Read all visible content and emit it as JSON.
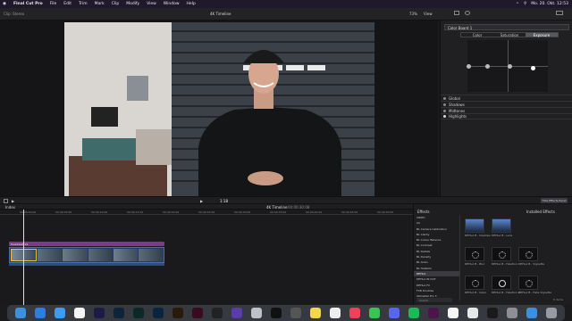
{
  "menubar": {
    "app": "Final Cut Pro",
    "items": [
      "File",
      "Edit",
      "Trim",
      "Mark",
      "Clip",
      "Modify",
      "View",
      "Window",
      "Help"
    ],
    "clock": "Mo. 20. Okt. 12:53"
  },
  "toolbar": {
    "viewer_title": "4K Timeline",
    "zoom": "73%",
    "view_label": "View",
    "clip_label": "Clip: Stereo"
  },
  "inspector": {
    "dropdown": "Color Board 1",
    "tabs": [
      "Color",
      "Saturation",
      "Exposure"
    ],
    "active_tab": "Exposure",
    "rows": [
      "Global",
      "Shadows",
      "Midtones",
      "Highlights"
    ]
  },
  "midbar": {
    "timecode": "1:18",
    "effects_title": "Installed Effects",
    "button": "Hide Effects Panel"
  },
  "timeline": {
    "index_label": "Index",
    "project": "4K Timeline",
    "duration": "00:00:30:08",
    "ruler": [
      "00:00:00:00",
      "00:00:05:00",
      "00:00:10:00",
      "00:00:15:00",
      "00:00:20:00",
      "00:00:25:00",
      "00:00:30:00",
      "00:00:35:00",
      "00:00:40:00",
      "00:00:45:00",
      "00:00:50:00"
    ],
    "audio_clip_label": "Musikbett 01"
  },
  "effects": {
    "header": "Effects",
    "categories": [
      "VIDEO",
      "All",
      "BL Camera Calibration",
      "BL Clarity",
      "BL Colour Balance",
      "BL Contrast",
      "BL Details",
      "BL Density",
      "BL Grain",
      "BL Halation",
      "DEHLA",
      "DEHLA IN OUT",
      "DEHLA FX",
      "FXD Doubles",
      "Yellowtail Pro 3"
    ],
    "selected_category": "DEHLA",
    "items": [
      "DEHLA B - Doubles",
      "DEHLA B - Lens",
      "DEHLA B - Blur",
      "DEHLA B - Halation",
      "DEHLA B - Vignette",
      "DEHLA B - Glow",
      "DEHLA B - Halation 2",
      "DEHLA B - Fade Vignette"
    ],
    "count": "8 items",
    "search_placeholder": "Search"
  },
  "dock": {
    "apps": [
      "Finder",
      "Safari",
      "Mail",
      "Calendar",
      "Premiere",
      "Lightroom",
      "Audition",
      "Photoshop",
      "Illustrator",
      "InDesign",
      "Final Cut",
      "Motion",
      "Compressor",
      "CapCut",
      "Logic",
      "Notes",
      "Photos",
      "Music",
      "Messages",
      "Discord",
      "Spotify",
      "Slack",
      "Notion",
      "Chrome",
      "Terminal",
      "Settings",
      "Downloads",
      "Trash"
    ]
  }
}
